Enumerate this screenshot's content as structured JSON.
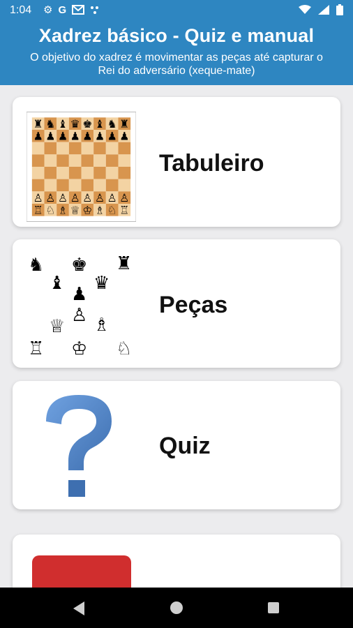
{
  "status_bar": {
    "time": "1:04",
    "left_icons": [
      "settings-icon",
      "google-icon",
      "gmail-icon",
      "dots-icon"
    ],
    "right_icons": [
      "wifi-icon",
      "signal-icon",
      "battery-icon"
    ]
  },
  "header": {
    "title": "Xadrez básico - Quiz e manual",
    "subtitle": "O objetivo do xadrez é movimentar as peças até capturar o Rei do adversário (xeque-mate)",
    "background": "#2e86c1"
  },
  "cards": [
    {
      "label": "Tabuleiro",
      "image": "chessboard-image"
    },
    {
      "label": "Peças",
      "image": "chess-pieces-image"
    },
    {
      "label": "Quiz",
      "image": "question-mark-image"
    },
    {
      "label": "",
      "image": "red-tile-image"
    }
  ],
  "board": {
    "top_row": "♜♞♝♛♚♝♞♜",
    "top_pawns": "♟♟♟♟♟♟♟♟",
    "bottom_pawns": "♙♙♙♙♙♙♙♙",
    "bottom_row": "♖♘♗♕♔♗♘♖",
    "light_color": "#f3d3a3",
    "dark_color": "#d8954e"
  },
  "pieces": {
    "black_knight": "♞",
    "black_king": "♚",
    "black_rook": "♜",
    "black_bishop": "♝",
    "black_queen": "♛",
    "black_pawn": "♟",
    "white_pawn": "♙",
    "white_queen": "♕",
    "white_bishop": "♗",
    "white_rook": "♖",
    "white_king": "♔",
    "white_knight": "♘"
  },
  "nav_bar": {
    "icons": [
      "back-icon",
      "home-icon",
      "recents-icon"
    ]
  }
}
